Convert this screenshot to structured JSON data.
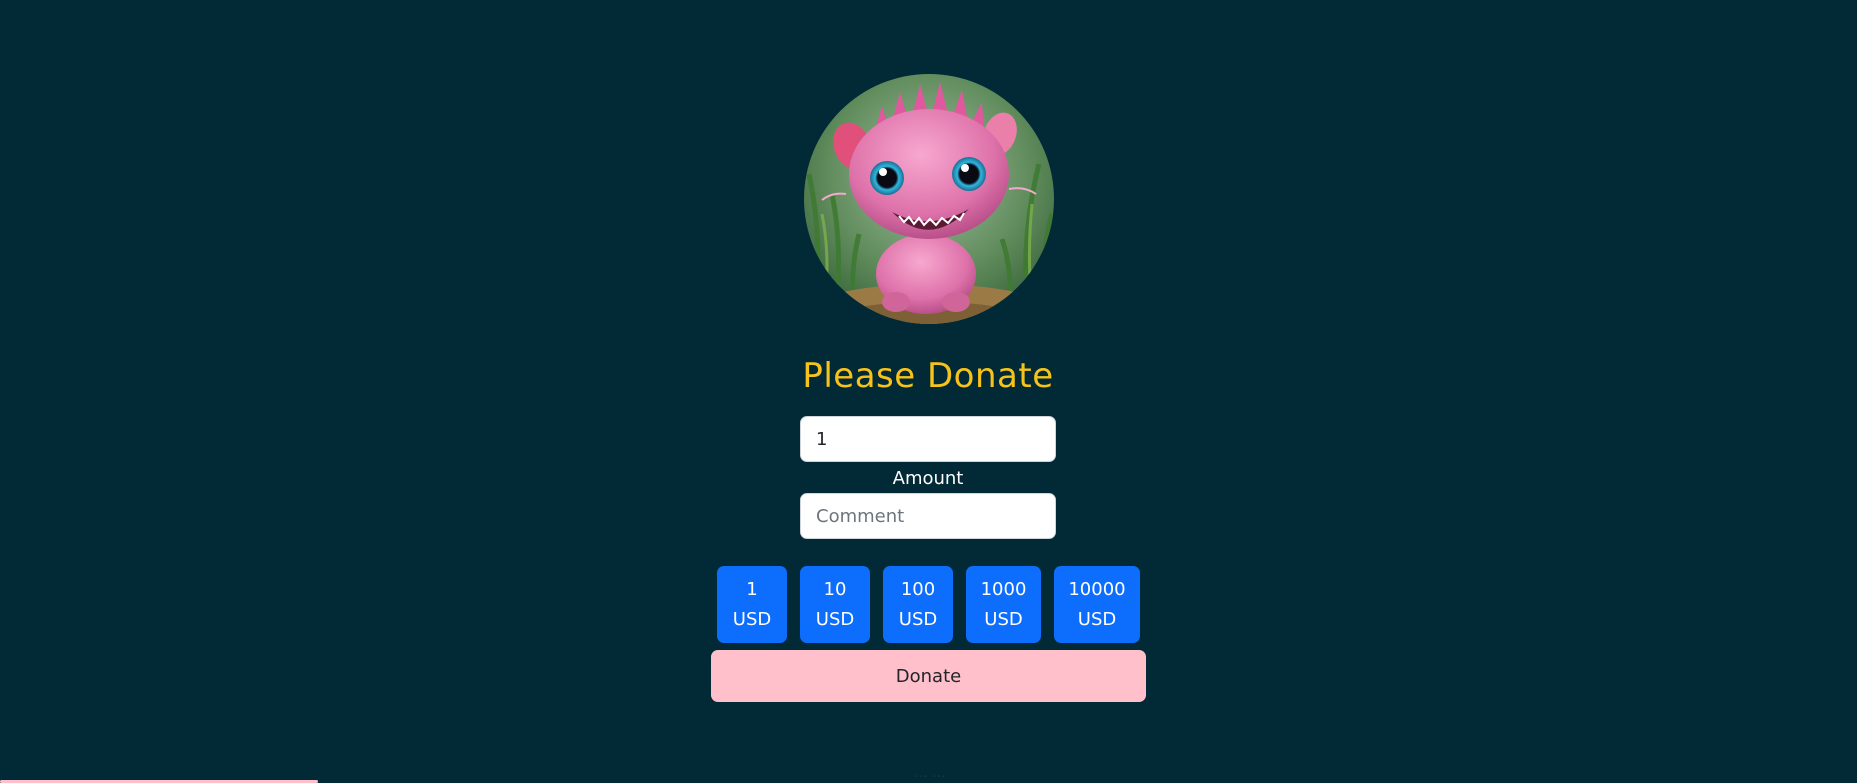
{
  "colors": {
    "page_background": "#012a36",
    "title": "#f6c31a",
    "label": "#ffffff",
    "preset_button_bg": "#0d6efd",
    "preset_button_text": "#ffffff",
    "donate_button_bg": "#ffc0cb",
    "donate_button_text": "#212529",
    "footer_text": "#0e3b47",
    "bottom_bar": "#ffc0cb"
  },
  "avatar": {
    "image": "pink-axolotl-creature",
    "alt": "Cute pink creature"
  },
  "title": "Please Donate",
  "form": {
    "amount_value": "1",
    "amount_label": "Amount",
    "comment_value": "",
    "comment_placeholder": "Comment"
  },
  "presets": [
    {
      "value": "1",
      "unit": "USD"
    },
    {
      "value": "10",
      "unit": "USD"
    },
    {
      "value": "100",
      "unit": "USD"
    },
    {
      "value": "1000",
      "unit": "USD"
    },
    {
      "value": "10000",
      "unit": "USD"
    }
  ],
  "donate_label": "Donate",
  "footer_text": "... ..."
}
